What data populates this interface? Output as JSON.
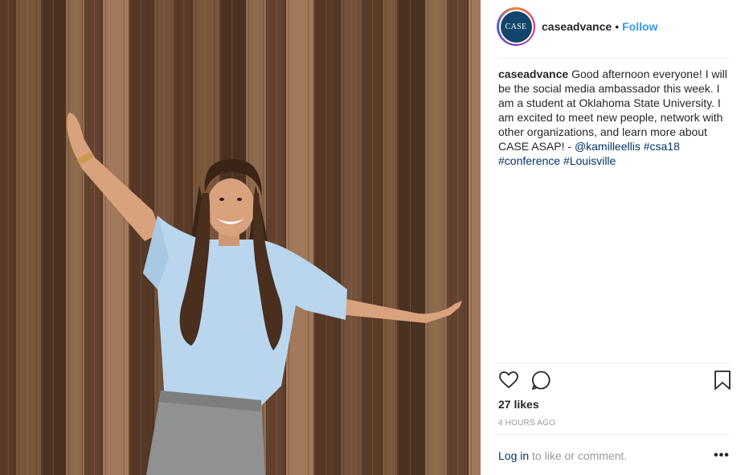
{
  "post": {
    "username": "caseadvance",
    "dot": "•",
    "follow_label": "Follow",
    "avatar_text": "CASE",
    "caption_user": "caseadvance",
    "caption_text": " Good afternoon everyone! I will be the social media ambassador this week. I am a student at Oklahoma State University. I am excited to meet new people, network with other organizations, and learn more about CASE ASAP! - ",
    "mention": "@kamilleellis",
    "tags": [
      "#csa18",
      "#conference",
      "#Louisville"
    ],
    "likes": "27 likes",
    "time": "4 HOURS AGO",
    "login_link": "Log in",
    "login_suffix": " to like or comment.",
    "more_label": "•••"
  },
  "icons": {
    "like": "heart-icon",
    "comment": "comment-icon",
    "save": "bookmark-icon",
    "more": "more-options-icon"
  },
  "colors": {
    "follow": "#3897f0",
    "link": "#003569",
    "wood_dark": "#4a3222",
    "wood_light": "#a2785a",
    "shirt": "#b9d6ee",
    "avatar_bg": "#12456b"
  }
}
